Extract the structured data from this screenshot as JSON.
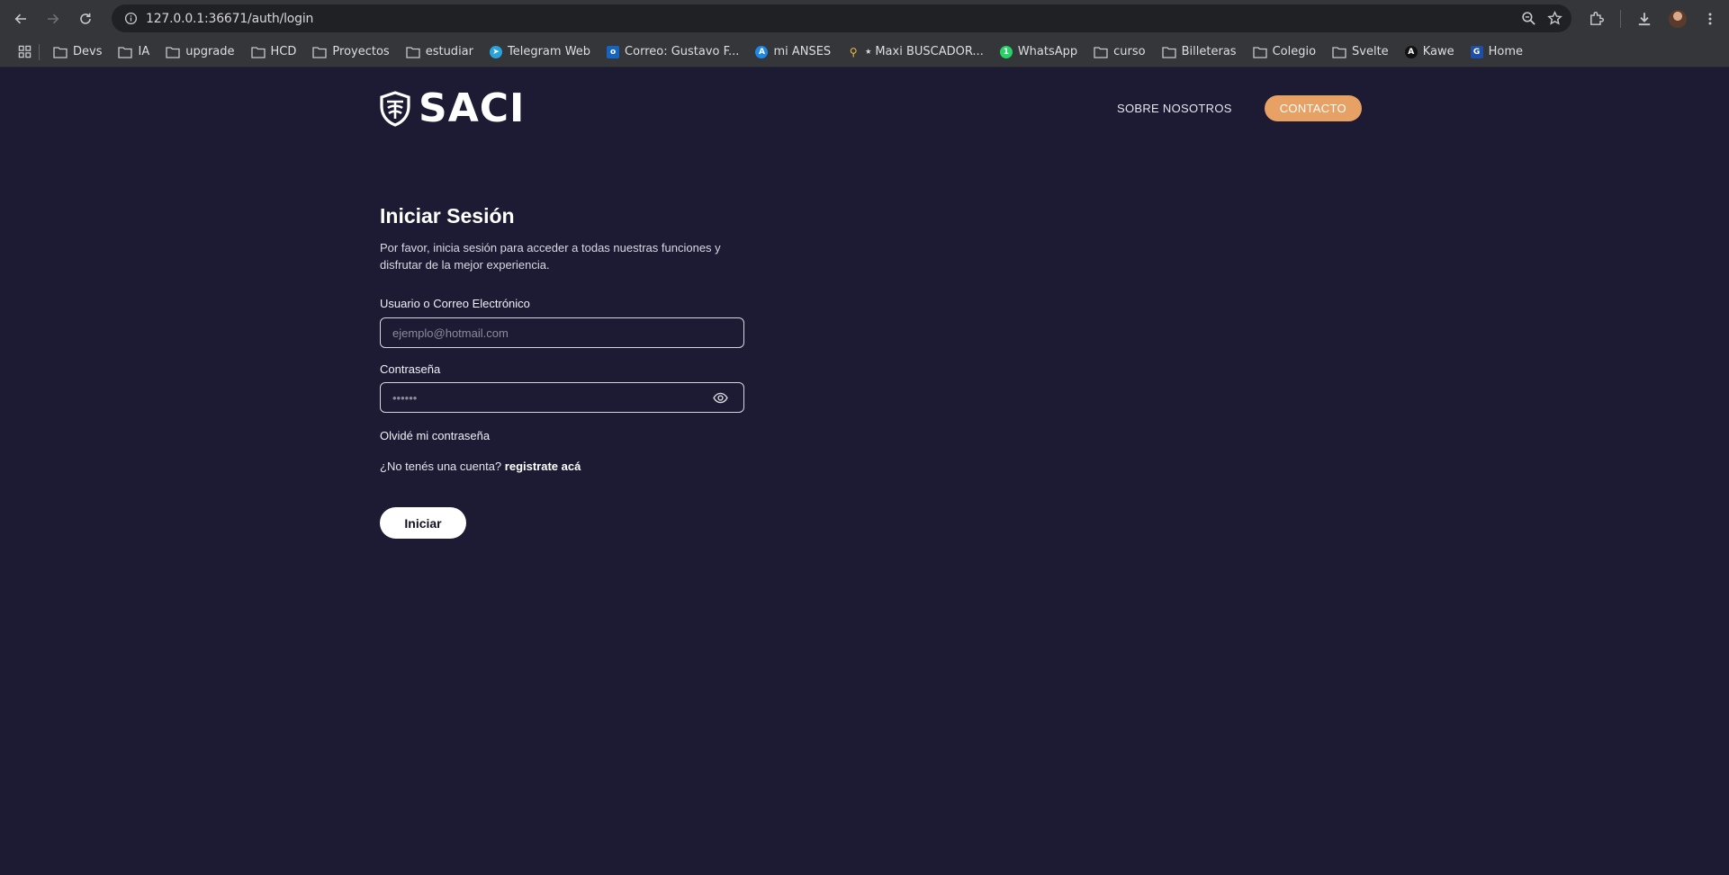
{
  "browser": {
    "url": "127.0.0.1:36671/auth/login",
    "bookmarks": [
      {
        "label": "Devs",
        "icon": "folder-icon"
      },
      {
        "label": "IA",
        "icon": "folder-icon"
      },
      {
        "label": "upgrade",
        "icon": "folder-icon"
      },
      {
        "label": "HCD",
        "icon": "folder-icon"
      },
      {
        "label": "Proyectos",
        "icon": "folder-icon"
      },
      {
        "label": "estudiar",
        "icon": "folder-icon"
      },
      {
        "label": "Telegram Web",
        "icon": "telegram-icon"
      },
      {
        "label": "Correo: Gustavo F...",
        "icon": "outlook-icon"
      },
      {
        "label": "mi ANSES",
        "icon": "anses-icon"
      },
      {
        "label": "⭑ Maxi BUSCADOR...",
        "icon": "search-favicon"
      },
      {
        "label": "WhatsApp",
        "icon": "whatsapp-icon"
      },
      {
        "label": "curso",
        "icon": "folder-icon"
      },
      {
        "label": "Billeteras",
        "icon": "folder-icon"
      },
      {
        "label": "Colegio",
        "icon": "folder-icon"
      },
      {
        "label": "Svelte",
        "icon": "folder-icon"
      },
      {
        "label": "Kawe",
        "icon": "kawe-icon"
      },
      {
        "label": "Home",
        "icon": "home-favicon"
      }
    ],
    "whatsapp_badge": "1"
  },
  "header": {
    "logo_text": "SACI",
    "nav_about": "SOBRE NOSOTROS",
    "nav_contact": "CONTACTO",
    "contact_color": "#e8a165"
  },
  "login": {
    "title": "Iniciar Sesión",
    "subtitle": "Por favor, inicia sesión para acceder a todas nuestras funciones y disfrutar de la mejor experiencia.",
    "user_label": "Usuario o Correo Electrónico",
    "user_placeholder": "ejemplo@hotmail.com",
    "password_label": "Contraseña",
    "password_placeholder": "••••••",
    "forgot": "Olvidé mi contraseña",
    "no_account": "¿No tenés una cuenta?",
    "register_link": "registrate acá",
    "submit": "Iniciar"
  },
  "colors": {
    "page_bg": "#1c1b33",
    "chrome_bg": "#35363a"
  }
}
